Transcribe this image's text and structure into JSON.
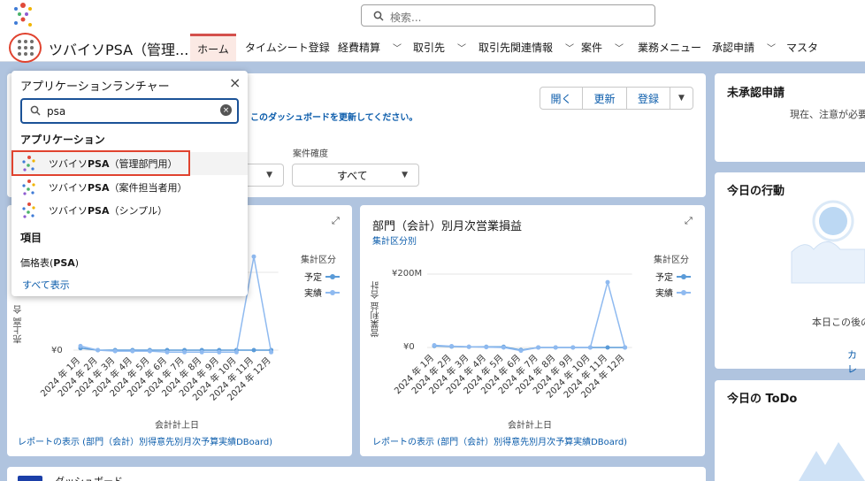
{
  "header": {
    "search_placeholder": "検索...",
    "app_name": "ツバイソPSA（管理..."
  },
  "tabs": [
    {
      "label": "ホーム",
      "dropdown": false,
      "active": true
    },
    {
      "label": "タイムシート登録",
      "dropdown": false
    },
    {
      "label": "経費精算",
      "dropdown": true
    },
    {
      "label": "取引先",
      "dropdown": true
    },
    {
      "label": "取引先関連情報",
      "dropdown": true
    },
    {
      "label": "案件",
      "dropdown": true
    },
    {
      "label": "業務メニュー",
      "dropdown": false
    },
    {
      "label": "承認申請",
      "dropdown": true
    },
    {
      "label": "マスタ",
      "dropdown": false
    }
  ],
  "dashboard": {
    "buttons": {
      "open": "開く",
      "refresh": "更新",
      "register": "登録"
    },
    "refresh_notice": "このダッシュボードを更新してください。",
    "filter_label": "案件確度",
    "filter_value": "すべて"
  },
  "launcher": {
    "title": "アプリケーションランチャー",
    "search_value": "psa",
    "section_apps": "アプリケーション",
    "apps": [
      {
        "pre": "ツバイソ",
        "bold": "PSA",
        "post": "（管理部門用）"
      },
      {
        "pre": "ツバイソ",
        "bold": "PSA",
        "post": "（案件担当者用）"
      },
      {
        "pre": "ツバイソ",
        "bold": "PSA",
        "post": "（シンプル）"
      }
    ],
    "section_items": "項目",
    "item": {
      "pre": "価格表(",
      "bold": "PSA",
      "post": ")"
    },
    "show_all": "すべて表示"
  },
  "chart_left": {
    "legend_title": "集計区分",
    "series": [
      "予定",
      "実績"
    ],
    "ylabel_partial": "売上高 合",
    "ytick_zero": "¥0",
    "xlabel": "会計計上日",
    "report_link": "レポートの表示 (部門（会計）別得意先別月次予算実績DBoard)"
  },
  "chart_right": {
    "title": "部門（会計）別月次営業損益",
    "subtitle": "集計区分別",
    "legend_title": "集計区分",
    "series": [
      "予定",
      "実績"
    ],
    "ylabel": "営業利益 合計",
    "yticks": [
      "¥200M",
      "¥0"
    ],
    "xlabel": "会計計上日",
    "report_link": "レポートの表示 (部門（会計）別得意先別月次予算実績DBoard)"
  },
  "chart_data": [
    {
      "type": "line",
      "categories": [
        "2024 年 1月",
        "2024 年 2月",
        "2024 年 3月",
        "2024 年 4月",
        "2024 年 5月",
        "2024 年 6月",
        "2024 年 7月",
        "2024 年 8月",
        "2024 年 9月",
        "2024 年 10月",
        "2024 年 11月",
        "2024 年 12月"
      ],
      "series": [
        {
          "name": "予定",
          "values": [
            1,
            0,
            0,
            0,
            0,
            0,
            0,
            0,
            0,
            0,
            0,
            0
          ]
        },
        {
          "name": "実績",
          "values": [
            2,
            0,
            -0.5,
            -0.5,
            -0.5,
            -1,
            -1,
            -1,
            -1,
            -1,
            46,
            -1
          ]
        }
      ],
      "xlabel": "会計計上日"
    },
    {
      "type": "line",
      "title": "部門（会計）別月次営業損益",
      "categories": [
        "2024 年 1月",
        "2024 年 2月",
        "2024 年 3月",
        "2024 年 4月",
        "2024 年 5月",
        "2024 年 6月",
        "2024 年 7月",
        "2024 年 8月",
        "2024 年 9月",
        "2024 年 10月",
        "2024 年 11月",
        "2024 年 12月"
      ],
      "series": [
        {
          "name": "予定",
          "values": [
            5,
            3,
            2,
            2,
            2,
            -8,
            0,
            0,
            0,
            0,
            0,
            0
          ]
        },
        {
          "name": "実績",
          "values": [
            7,
            4,
            2,
            1,
            0,
            -10,
            0,
            0,
            0,
            0,
            205,
            0
          ]
        }
      ],
      "yticks": [
        "¥200M",
        "¥0"
      ],
      "ylim": [
        -20,
        220
      ],
      "xlabel": "会計計上日",
      "ylabel": "営業利益 合計"
    }
  ],
  "right_panel": {
    "pending_title": "未承認申請",
    "pending_text": "現在、注意が必要",
    "today_action_title": "今日の行動",
    "today_action_text": "本日この後の",
    "today_action_link": "カレ",
    "todo_title": "今日の ToDo"
  },
  "bottom": {
    "partial_title": "ダッシュボード"
  },
  "colors": {
    "accent": "#0b5cab",
    "highlight": "#e0432f",
    "series_plan": "#5a9bd8",
    "series_actual": "#8fbaf0"
  }
}
